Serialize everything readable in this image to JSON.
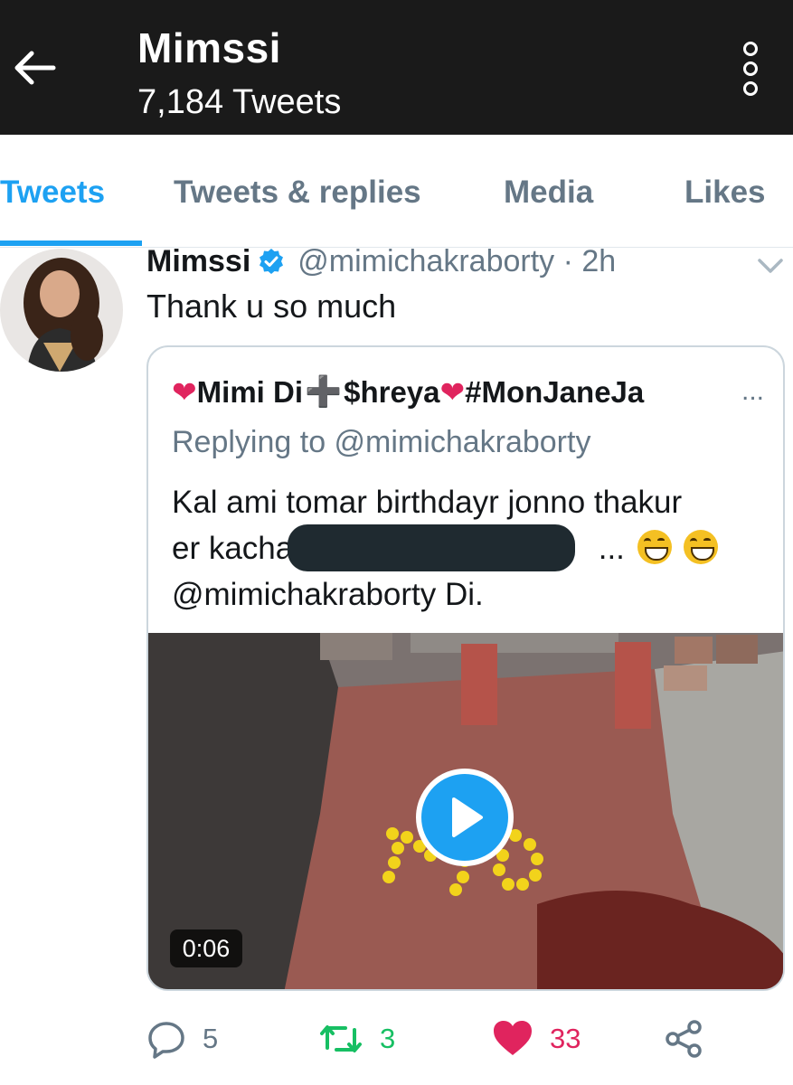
{
  "header": {
    "title": "Mimssi",
    "subtitle": "7,184 Tweets",
    "background": "#1a1a1a"
  },
  "tabs": [
    {
      "label": "Tweets",
      "active": true
    },
    {
      "label": "Tweets & replies",
      "active": false
    },
    {
      "label": "Media",
      "active": false
    },
    {
      "label": "Likes",
      "active": false
    }
  ],
  "tweet": {
    "author_name": "Mimssi",
    "handle_time": "@mimichakraborty · 2h",
    "text": "Thank u so much",
    "verified": true,
    "quoted": {
      "author_prefix": "❤",
      "author_part1": "Mimi Di",
      "author_plus": "➕",
      "author_part2": "$hreya",
      "author_heart2": "❤",
      "author_part3": "#MonJaneJa",
      "ellipsis": "...",
      "replying": "Replying to @mimichakraborty",
      "line1": "Kal ami tomar birthdayr jonno thakur",
      "line2_start": "er kacha",
      "line2_end": "...",
      "line3": "@mimichakraborty  Di.",
      "video_duration": "0:06"
    },
    "actions": {
      "replies": "5",
      "retweets": "3",
      "likes": "33"
    }
  },
  "colors": {
    "accent": "#1da1f2",
    "retweet": "#17bf63",
    "like": "#e0245e",
    "muted": "#657786"
  },
  "icons": [
    "back-arrow-icon",
    "overflow-menu-icon",
    "verified-badge-icon",
    "chevron-down-icon",
    "play-icon",
    "reply-icon",
    "retweet-icon",
    "heart-icon",
    "share-icon",
    "grinning-emoji-icon"
  ]
}
